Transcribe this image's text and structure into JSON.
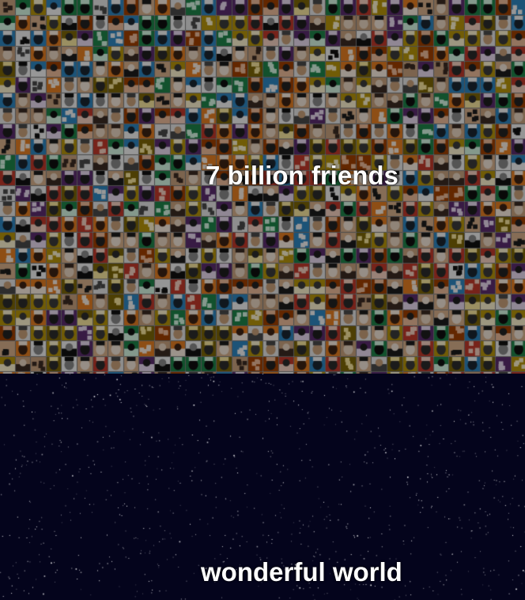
{
  "headline_top": "7 billion friends",
  "headline_bottom": "wonderful world",
  "colors": {
    "text": "#ffffff",
    "night_sky": "#04041c",
    "star": "#ffffff"
  },
  "mosaic": {
    "description_tiles": "grid of small profile-photo thumbnails"
  }
}
